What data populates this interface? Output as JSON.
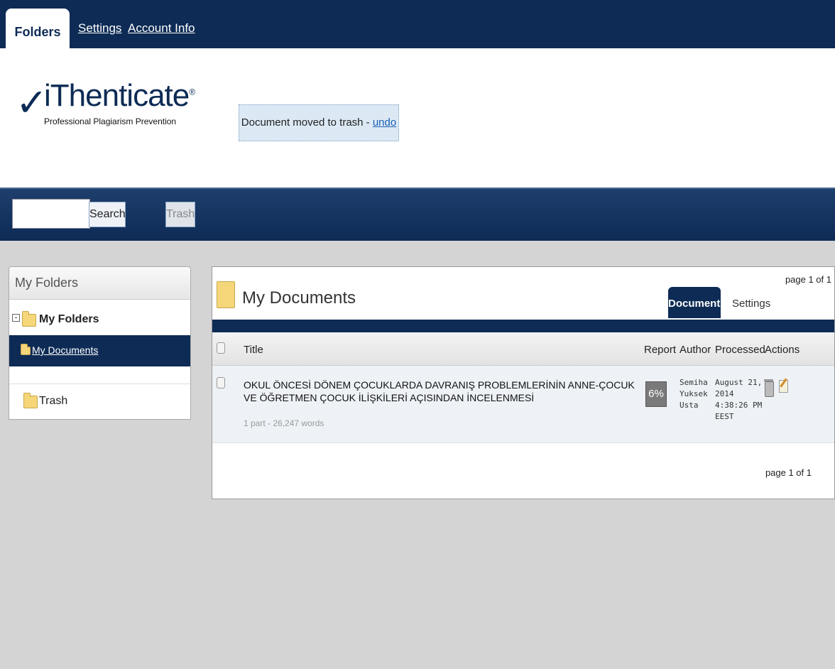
{
  "nav": {
    "active_tab": "Folders",
    "links": [
      "Settings",
      "Account Info"
    ]
  },
  "brand": {
    "name": "iThenticate",
    "tagline": "Professional Plagiarism Prevention"
  },
  "notice": {
    "text": "Document moved to trash - ",
    "link": "undo"
  },
  "search": {
    "value": "",
    "button": "Search",
    "trash_button": "Trash"
  },
  "left_panel": {
    "header": "My Folders",
    "root": "My Folders",
    "selected": "My Documents",
    "trash": "Trash"
  },
  "main": {
    "title": "My Documents",
    "page_info": "page 1 of 1",
    "tabs": [
      "Documents",
      "Settings"
    ],
    "columns": {
      "title": "Title",
      "report": "Report",
      "author": "Author",
      "processed": "Processed",
      "actions": "Actions"
    },
    "rows": [
      {
        "title": "OKUL ÖNCESİ DÖNEM ÇOCUKLARDA DAVRANIŞ PROBLEMLERİNİN ANNE-ÇOCUK VE ÖĞRETMEN ÇOCUK İLİŞKİLERİ AÇISINDAN İNCELENMESİ",
        "meta": "1 part - 26,247 words",
        "report": "6%",
        "author": [
          "Semiha",
          "Yuksek",
          "Usta"
        ],
        "processed": [
          "August 21,",
          "2014",
          "4:38:26 PM",
          "EEST"
        ]
      }
    ],
    "page_info_bottom": "page 1 of 1"
  }
}
